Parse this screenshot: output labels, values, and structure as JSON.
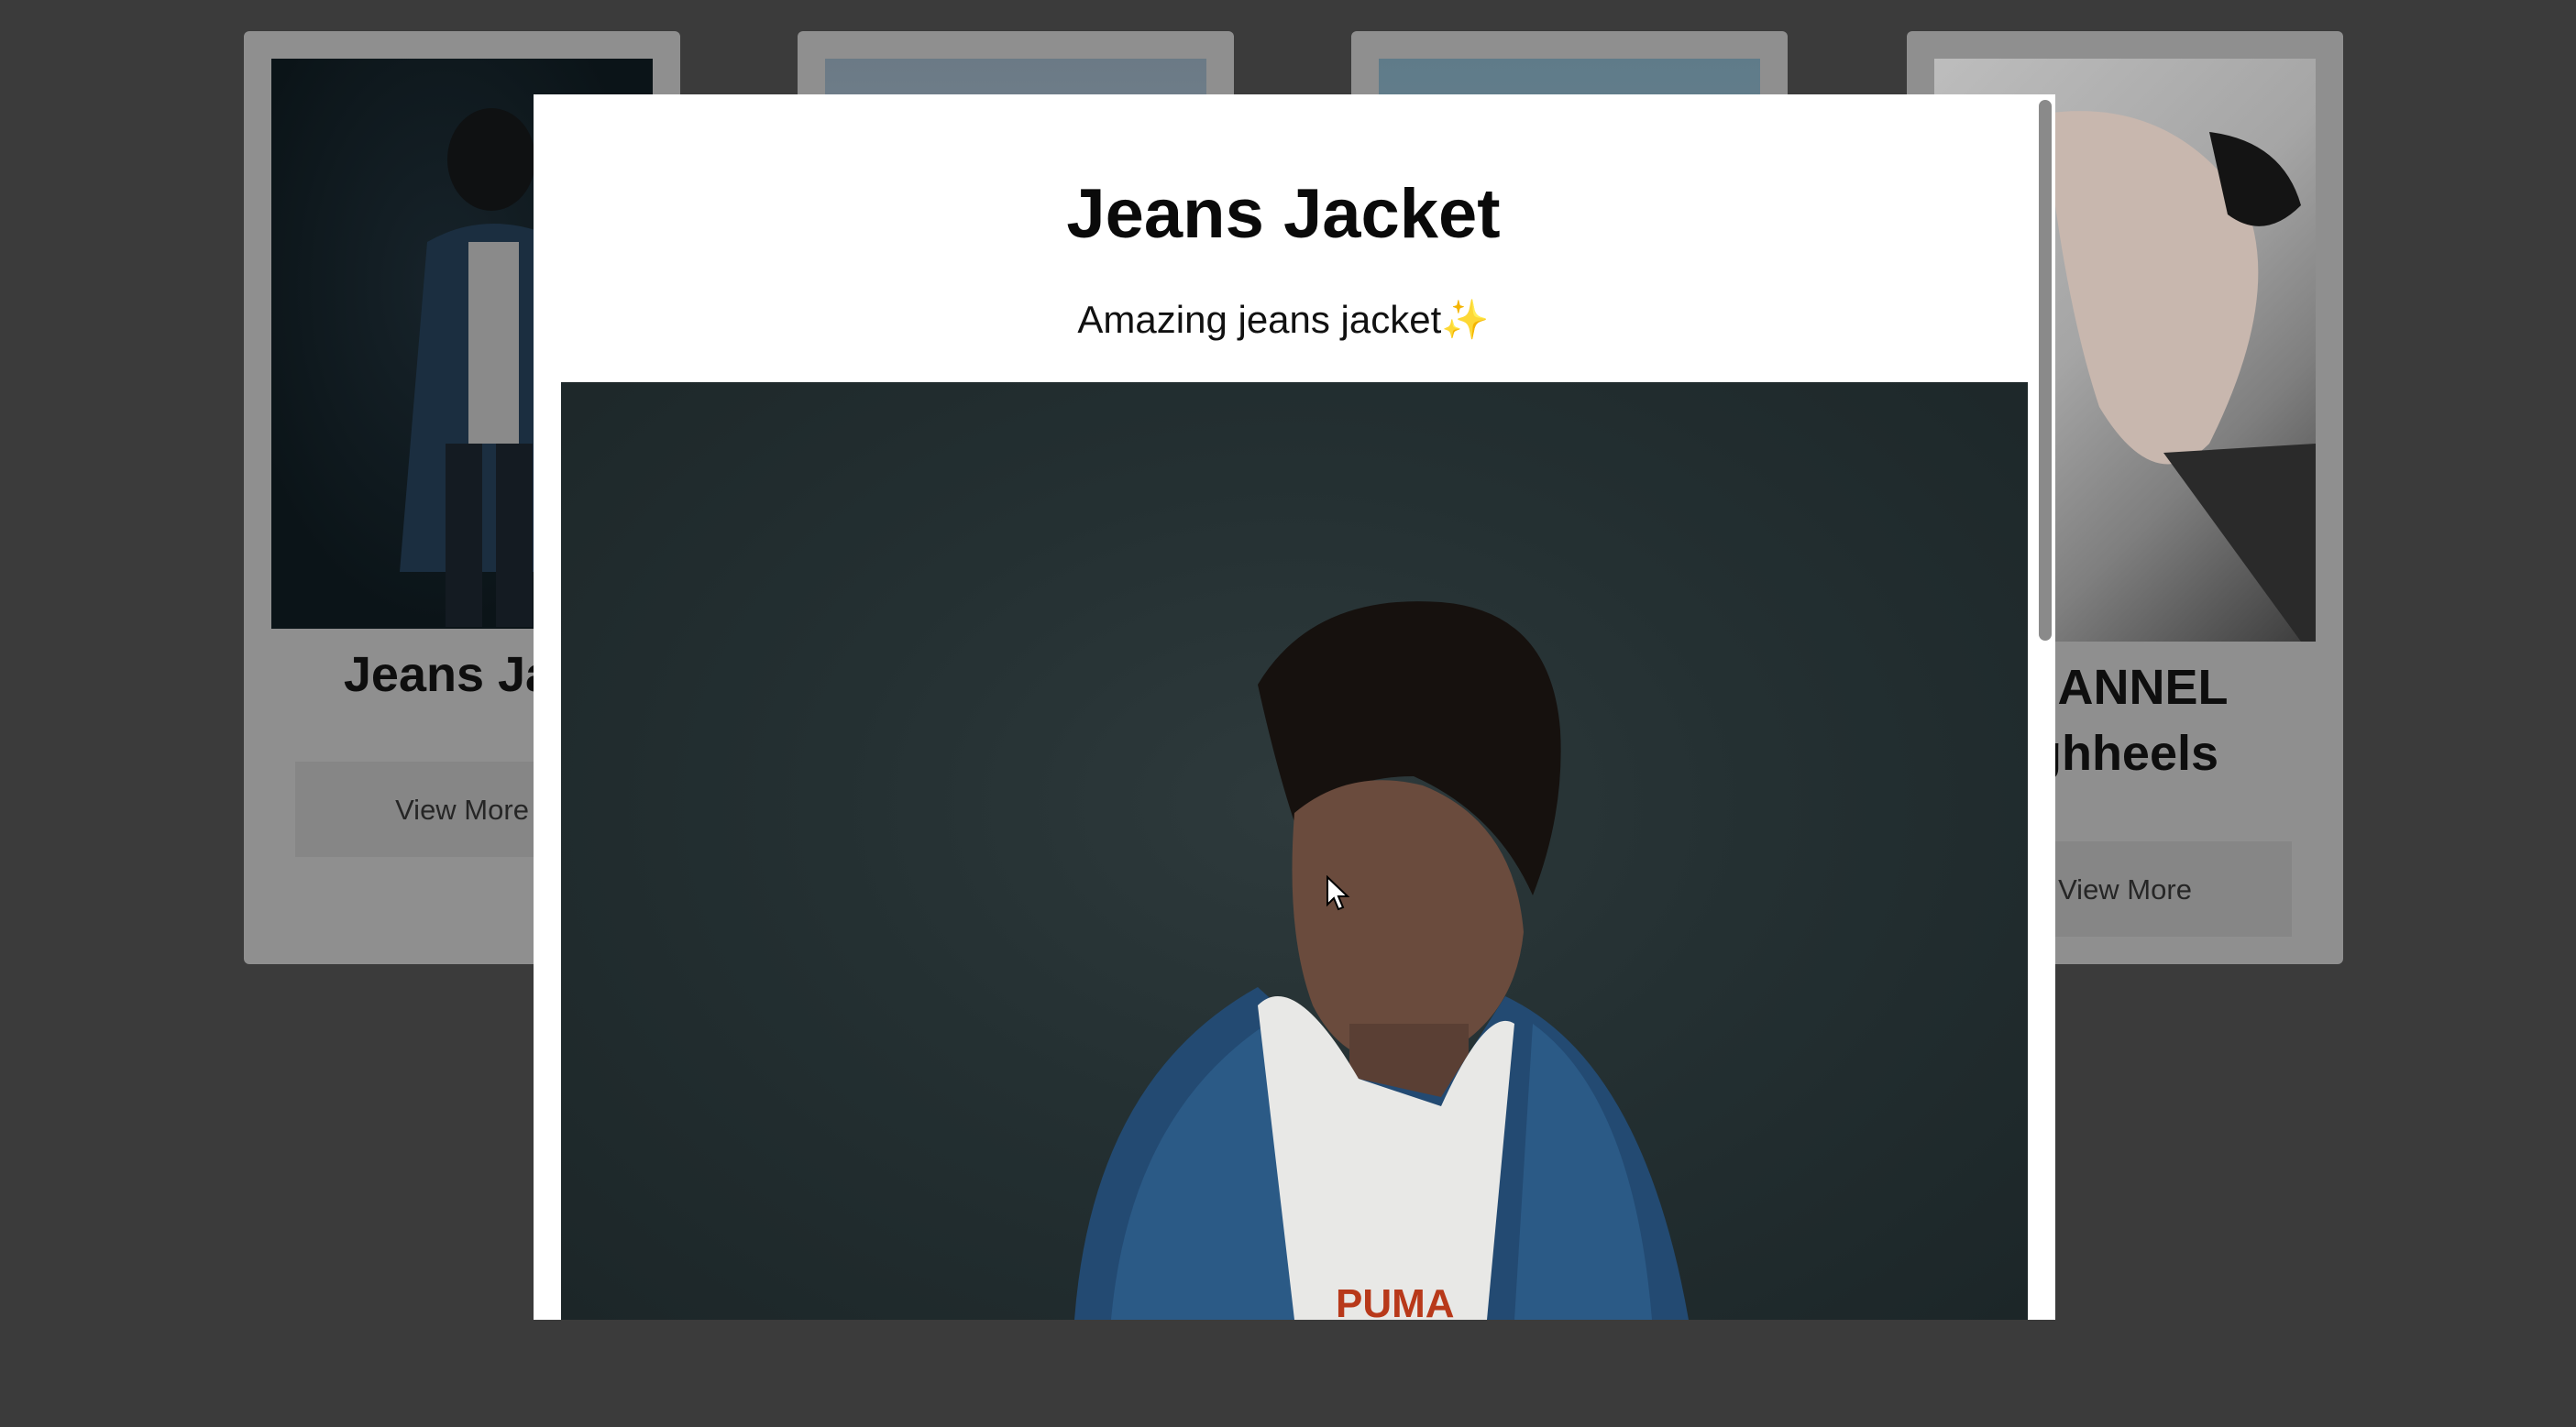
{
  "cards": [
    {
      "title": "Jeans Jac",
      "button": "View More",
      "image_icon": "jeans-photo"
    },
    {
      "title": "",
      "button": "",
      "image_icon": "sky-photo"
    },
    {
      "title": "",
      "button": "",
      "image_icon": "sky-photo"
    },
    {
      "title_line1": "HANNEL",
      "title_line2": "ghheels",
      "button": "View More",
      "image_icon": "heels-photo"
    }
  ],
  "modal": {
    "title": "Jeans Jacket",
    "description": "Amazing jeans jacket✨",
    "image_icon": "jeans-jacket-photo"
  },
  "colors": {
    "overlay": "#3b3b3b",
    "card": "#8f8f8f",
    "modal_bg": "#ffffff",
    "scrollbar": "#8a8a8a"
  }
}
